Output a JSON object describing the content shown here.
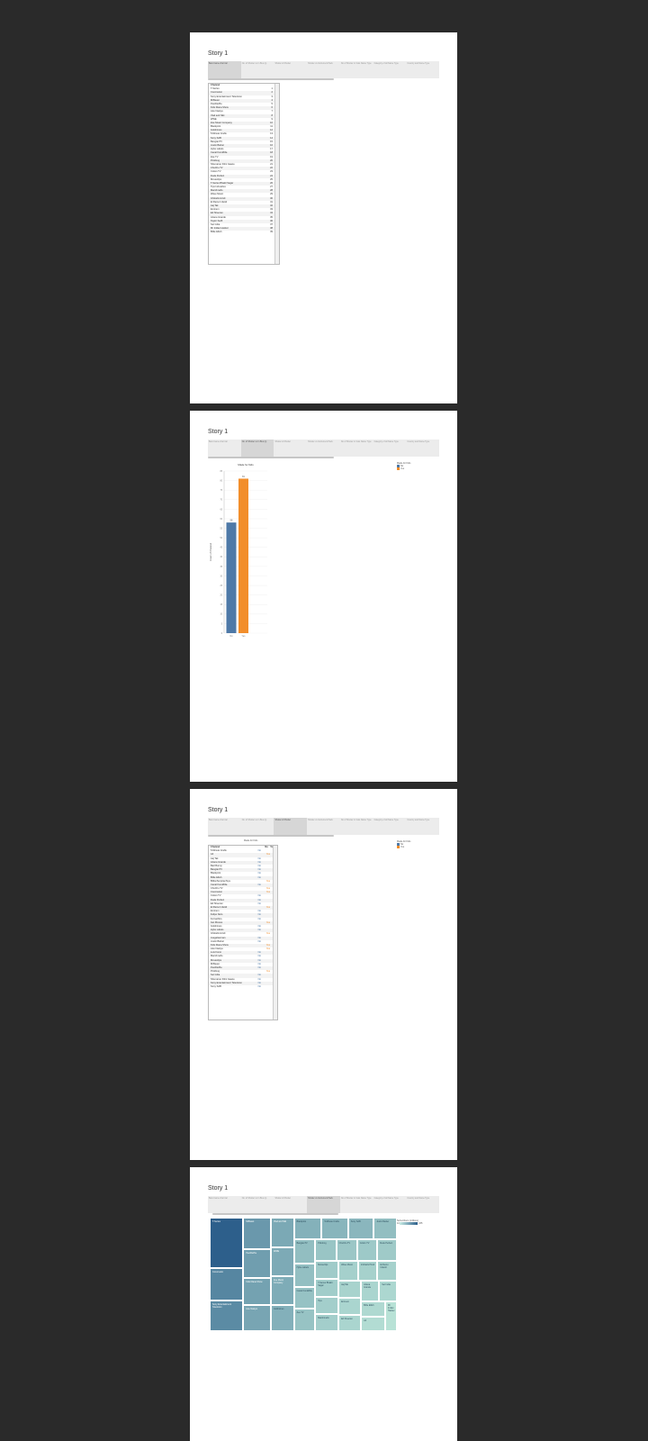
{
  "story_title": "Story 1",
  "tabs": [
    "Band name chart tal",
    "No. of Shutter vs In Bus (s)",
    "Shutter & Shutter",
    "Shutter vs Instrument Pack",
    "No of Shutter in Cats Name Type",
    "Category of all Name Type",
    "Country and Name Type"
  ],
  "colors": {
    "no": "#4e79a7",
    "yes": "#f28e2b",
    "tm_dark": "#2d5f8b",
    "tm_light": "#b8e2d6"
  },
  "panel1": {
    "header": "Channel",
    "rows": [
      {
        "name": "T-Series",
        "value": "1"
      },
      {
        "name": "Cocomelon",
        "value": "2"
      },
      {
        "name": "Sony Entertainment Television",
        "value": "3"
      },
      {
        "name": "MrBeast",
        "value": "4"
      },
      {
        "name": "PewDiePie",
        "value": "5"
      },
      {
        "name": "Kids Diana Show",
        "value": "6"
      },
      {
        "name": "Like Nastya",
        "value": "7"
      },
      {
        "name": "Vlad and Niki",
        "value": "8"
      },
      {
        "name": "WWE",
        "value": "9"
      },
      {
        "name": "Zee Music Company",
        "value": "10"
      },
      {
        "name": "Blackpink",
        "value": "11"
      },
      {
        "name": "Goldmines",
        "value": "12"
      },
      {
        "name": "5-Minute Crafts",
        "value": "13"
      },
      {
        "name": "Sony SAB",
        "value": "14"
      },
      {
        "name": "BangtanTV",
        "value": "15"
      },
      {
        "name": "Justin Bieber",
        "value": "16"
      },
      {
        "name": "Hybe Labels",
        "value": "17"
      },
      {
        "name": "Canal KondZilla",
        "value": "18"
      },
      {
        "name": "Zee TV",
        "value": "19"
      },
      {
        "name": "Pinkfong",
        "value": "20"
      },
      {
        "name": "Shemaroo Filmi Gaane",
        "value": "21"
      },
      {
        "name": "ChuChu TV",
        "value": "22"
      },
      {
        "name": "Colors TV",
        "value": "23"
      },
      {
        "name": "Dude Perfect",
        "value": "24"
      },
      {
        "name": "Movieclips",
        "value": "25"
      },
      {
        "name": "T-Series Bhakti Sagar",
        "value": "26"
      },
      {
        "name": "Tips Industries",
        "value": "27"
      },
      {
        "name": "Marshmello",
        "value": "28"
      },
      {
        "name": "Wave Music",
        "value": "29"
      },
      {
        "name": "Infobells Hindi",
        "value": "30"
      },
      {
        "name": "El Reino Infantil",
        "value": "31"
      },
      {
        "name": "Aaj Tak",
        "value": "32"
      },
      {
        "name": "Eminem",
        "value": "33"
      },
      {
        "name": "Ed Sheeran",
        "value": "34"
      },
      {
        "name": "Ariana Grande",
        "value": "35"
      },
      {
        "name": "Taylor Swift",
        "value": "36"
      },
      {
        "name": "Set India",
        "value": "37"
      },
      {
        "name": "Mr Indian Hacker",
        "value": "38"
      },
      {
        "name": "Billie Eilish",
        "value": "39"
      }
    ]
  },
  "panel2": {
    "chart_data": {
      "type": "bar",
      "title": "Made for Kids",
      "categories": [
        "No",
        "Yes"
      ],
      "values": [
        58,
        81
      ],
      "ylabel": "Count of Channel",
      "ylim": [
        0,
        85
      ],
      "yticks": [
        0,
        5,
        10,
        15,
        20,
        25,
        30,
        35,
        40,
        45,
        50,
        55,
        60,
        65,
        70,
        75,
        80,
        85
      ],
      "legend_title": "Made for Kids",
      "legend": [
        "No",
        "Yes"
      ]
    }
  },
  "panel3": {
    "title": "Made for Kids",
    "col_header": "Channel",
    "cols": [
      "No",
      "Yes"
    ],
    "legend_title": "Made for Kids",
    "legend": [
      "No",
      "Yes"
    ],
    "rows": [
      {
        "name": "5-Minute Crafts",
        "v": "No"
      },
      {
        "name": "A4",
        "v": "Yes"
      },
      {
        "name": "Aaj Tak",
        "v": "No"
      },
      {
        "name": "Ariana Grande",
        "v": "No"
      },
      {
        "name": "Bad Bunny",
        "v": "No"
      },
      {
        "name": "BangtanTV",
        "v": "No"
      },
      {
        "name": "Blackpink",
        "v": "No"
      },
      {
        "name": "Billie Eilish",
        "v": "No"
      },
      {
        "name": "BillionSurpriseToys",
        "v": "Yes"
      },
      {
        "name": "Canal KondZilla",
        "v": "No"
      },
      {
        "name": "ChuChu TV",
        "v": "Yes"
      },
      {
        "name": "Cocomelon",
        "v": "Yes"
      },
      {
        "name": "Colors TV",
        "v": "No"
      },
      {
        "name": "Dude Perfect",
        "v": "No"
      },
      {
        "name": "Ed Sheeran",
        "v": "No"
      },
      {
        "name": "El Reino Infantil",
        "v": "Yes"
      },
      {
        "name": "Eminem",
        "v": "No"
      },
      {
        "name": "Felipe Neto",
        "v": "No"
      },
      {
        "name": "Fernanfloo",
        "v": "No"
      },
      {
        "name": "Get Movies",
        "v": "Yes"
      },
      {
        "name": "Goldmines",
        "v": "No"
      },
      {
        "name": "Hybe Labels",
        "v": "No"
      },
      {
        "name": "Infobells Hindi",
        "v": "Yes"
      },
      {
        "name": "JuegaGerman",
        "v": "No"
      },
      {
        "name": "Justin Bieber",
        "v": "No"
      },
      {
        "name": "Kids Diana Show",
        "v": "Yes"
      },
      {
        "name": "Like Nastya",
        "v": "Yes"
      },
      {
        "name": "Luis Fonsi",
        "v": "No"
      },
      {
        "name": "Marshmello",
        "v": "No"
      },
      {
        "name": "Movieclips",
        "v": "No"
      },
      {
        "name": "MrBeast",
        "v": "No"
      },
      {
        "name": "PewDiePie",
        "v": "No"
      },
      {
        "name": "Pinkfong",
        "v": "Yes"
      },
      {
        "name": "Set India",
        "v": "No"
      },
      {
        "name": "Shemaroo Filmi Gaane",
        "v": "No"
      },
      {
        "name": "Sony Entertainment Television",
        "v": "No"
      },
      {
        "name": "Sony SAB",
        "v": "No"
      }
    ]
  },
  "panel4": {
    "legend_title": "Subscribers (millions)",
    "legend_min": "10",
    "legend_max": "235",
    "cells": [
      {
        "name": "T-Series",
        "v": 235
      },
      {
        "name": "Cocomelon",
        "v": 152
      },
      {
        "name": "Sony Entertainment Television",
        "v": 143
      },
      {
        "name": "MrBeast",
        "v": 120
      },
      {
        "name": "PewDiePie",
        "v": 111
      },
      {
        "name": "Kids Diana Show",
        "v": 105
      },
      {
        "name": "Like Nastya",
        "v": 100
      },
      {
        "name": "Vlad and Niki",
        "v": 95
      },
      {
        "name": "WWE",
        "v": 93
      },
      {
        "name": "Zee Music Company",
        "v": 91
      },
      {
        "name": "Goldmines",
        "v": 85
      },
      {
        "name": "Blackpink",
        "v": 84
      },
      {
        "name": "5-Minute Crafts",
        "v": 80
      },
      {
        "name": "Sony SAB",
        "v": 78
      },
      {
        "name": "Justin Bieber",
        "v": 70
      },
      {
        "name": "BangtanTV",
        "v": 70
      },
      {
        "name": "Hybe Labels",
        "v": 69
      },
      {
        "name": "Canal KondZilla",
        "v": 66
      },
      {
        "name": "Zee TV",
        "v": 65
      },
      {
        "name": "Pinkfong",
        "v": 63
      },
      {
        "name": "ChuChu TV",
        "v": 62
      },
      {
        "name": "Colors TV",
        "v": 60
      },
      {
        "name": "Dude Perfect",
        "v": 59
      },
      {
        "name": "Movieclips",
        "v": 58
      },
      {
        "name": "T-Series Bhakti Sagar",
        "v": 57
      },
      {
        "name": "Tips",
        "v": 56
      },
      {
        "name": "Marshmello",
        "v": 56
      },
      {
        "name": "Wave Music",
        "v": 55
      },
      {
        "name": "Infobells Hindi",
        "v": 54
      },
      {
        "name": "El Reino Infantil",
        "v": 54
      },
      {
        "name": "Aaj Tak",
        "v": 53
      },
      {
        "name": "Eminem",
        "v": 52
      },
      {
        "name": "Ed Sheeran",
        "v": 52
      },
      {
        "name": "Ariana Grande",
        "v": 52
      },
      {
        "name": "Set India",
        "v": 51
      },
      {
        "name": "Billie Eilish",
        "v": 50
      },
      {
        "name": "A4",
        "v": 49
      },
      {
        "name": "Mr Indian Hacker",
        "v": 48
      }
    ]
  }
}
